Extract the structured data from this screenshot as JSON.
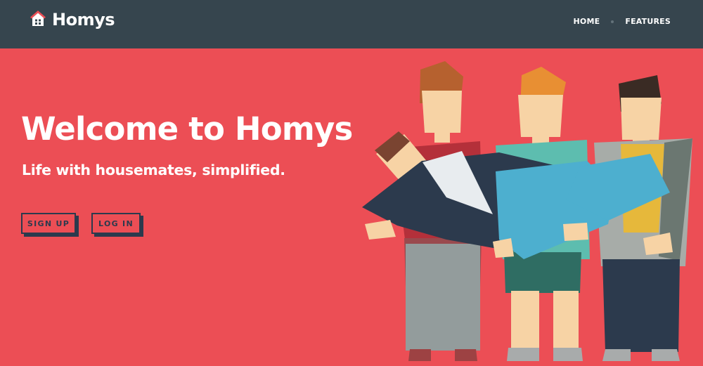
{
  "brand": {
    "name": "Homys",
    "icon": "house-icon",
    "color": "#ffffff",
    "icon_roof_color": "#ec4e55"
  },
  "nav": {
    "items": [
      {
        "label": "HOME"
      },
      {
        "label": "FEATURES"
      }
    ]
  },
  "hero": {
    "title": "Welcome to Homys",
    "subtitle": "Life with housemates, simplified.",
    "buttons": {
      "signup": "SIGN UP",
      "login": "LOG IN"
    }
  },
  "colors": {
    "navbar": "#36454e",
    "hero_bg": "#ec4e55",
    "button": "#2c3a4d",
    "text": "#ffffff"
  }
}
